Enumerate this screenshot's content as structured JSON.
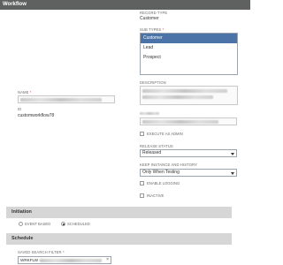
{
  "title": "Workflow",
  "record_type": {
    "label": "RECORD TYPE",
    "value": "Customer"
  },
  "sub_types": {
    "label": "SUB TYPES",
    "required": "*",
    "options": [
      "Customer",
      "Lead",
      "Prospect"
    ],
    "selected": "Customer"
  },
  "name": {
    "label": "NAME",
    "required": "*"
  },
  "description": {
    "label": "DESCRIPTION"
  },
  "id": {
    "label": "ID",
    "value": "customworkflow78"
  },
  "owner": {},
  "execute_as_admin": {
    "label": "EXECUTE AS ADMIN",
    "checked": false
  },
  "release_status": {
    "label": "RELEASE STATUS",
    "value": "Released"
  },
  "keep_instance": {
    "label": "KEEP INSTANCE AND HISTORY",
    "value": "Only When Testing"
  },
  "enable_logging": {
    "label": "ENABLE LOGGING",
    "checked": false
  },
  "inactive": {
    "label": "INACTIVE",
    "checked": false
  },
  "initiation": {
    "header": "Initiation",
    "options": [
      "EVENT BASED",
      "SCHEDULED"
    ],
    "selected": "SCHEDULED"
  },
  "schedule": {
    "header": "Schedule"
  },
  "saved_search_filter": {
    "label": "SAVED SEARCH FILTER",
    "required": "*",
    "value_prefix": "WRKFLW -",
    "clear": "×"
  },
  "icons": {
    "dropdown": "caret-down",
    "clear": "x"
  },
  "colors": {
    "titlebar": "#5f6161",
    "selection": "#4b73a8",
    "section_bar": "#d6d6d6",
    "required": "#d23c3c"
  }
}
